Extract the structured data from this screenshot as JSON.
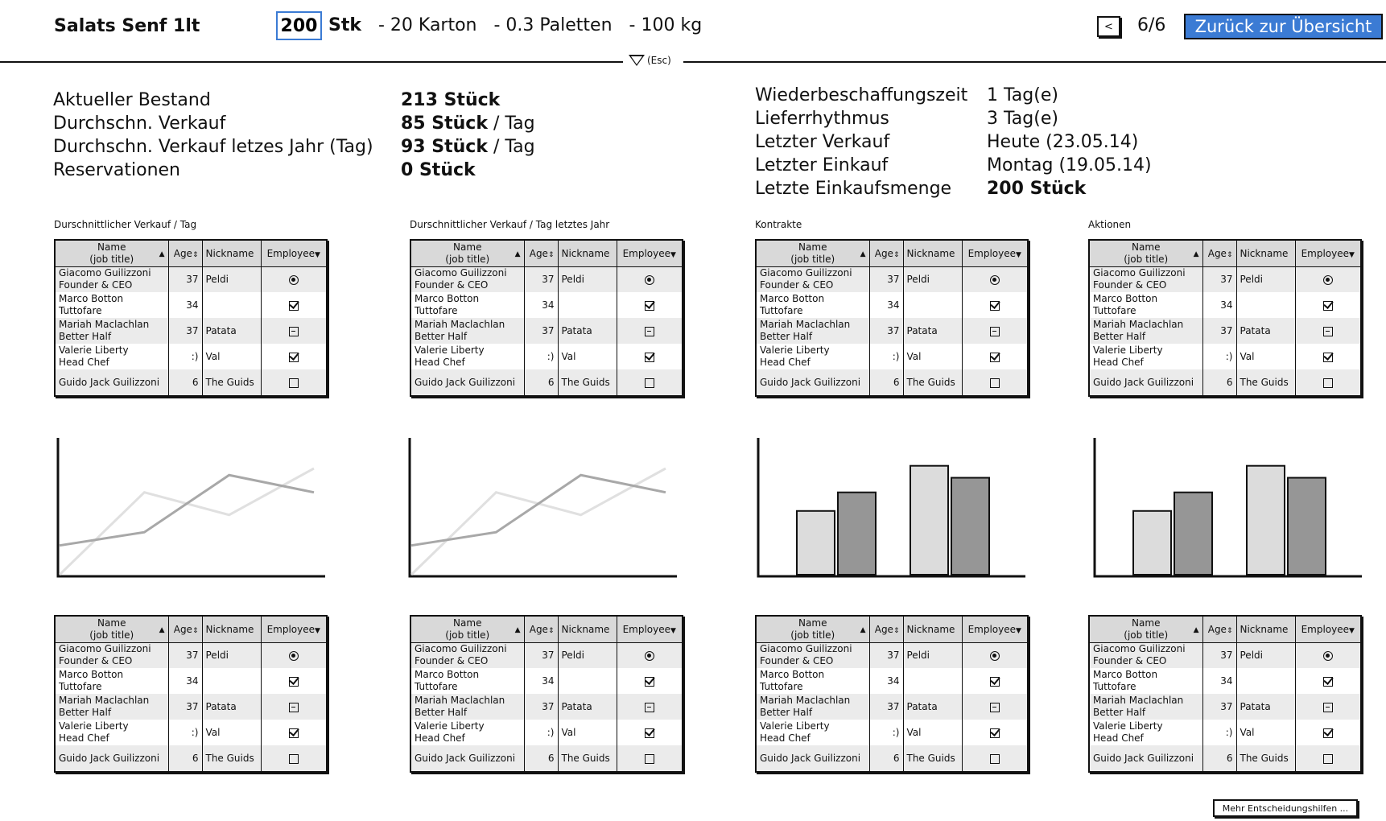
{
  "header": {
    "product": "Salats Senf 1lt",
    "quantity_value": "200",
    "unit": "Stk",
    "karton": "- 20 Karton",
    "paletten": "- 0.3 Paletten",
    "weight": "- 100 kg",
    "prev_label": "<",
    "pager": "6/6",
    "back_label": "Zurück zur Übersicht",
    "collapse_label": "(Esc)"
  },
  "stats_left": [
    {
      "label": "Aktueller Bestand",
      "value": "213 Stück",
      "suffix": ""
    },
    {
      "label": "Durchschn. Verkauf",
      "value": "85 Stück",
      "suffix": " / Tag"
    },
    {
      "label": "Durchschn. Verkauf letzes Jahr (Tag)",
      "value": "93 Stück",
      "suffix": " / Tag"
    },
    {
      "label": "Reservationen",
      "value": "0 Stück",
      "suffix": ""
    }
  ],
  "stats_right": [
    {
      "label": "Wiederbeschaffungszeit",
      "value": "1 Tag(e)",
      "bold": false
    },
    {
      "label": "Lieferrhythmus",
      "value": "3 Tag(e)",
      "bold": false
    },
    {
      "label": "Letzter Verkauf",
      "value": "Heute (23.05.14)",
      "bold": false
    },
    {
      "label": "Letzter Einkauf",
      "value": "Montag (19.05.14)",
      "bold": false
    },
    {
      "label": "Letzte Einkaufsmenge",
      "value": "200 Stück",
      "bold": true
    }
  ],
  "sections": [
    {
      "title": "Durschnittlicher Verkauf / Tag"
    },
    {
      "title": "Durschnittlicher Verkauf / Tag letztes Jahr"
    },
    {
      "title": "Kontrakte"
    },
    {
      "title": "Aktionen"
    }
  ],
  "table": {
    "headers": {
      "name": "Name",
      "name_sub": "(job title)",
      "age": "Age",
      "nickname": "Nickname",
      "employee": "Employee"
    },
    "rows": [
      {
        "name": "Giacomo Guilizzoni",
        "title": "Founder & CEO",
        "age": "37",
        "nickname": "Peldi",
        "employee": "radio"
      },
      {
        "name": "Marco Botton",
        "title": "Tuttofare",
        "age": "34",
        "nickname": "",
        "employee": "check"
      },
      {
        "name": "Mariah Maclachlan",
        "title": "Better Half",
        "age": "37",
        "nickname": "Patata",
        "employee": "minus"
      },
      {
        "name": "Valerie Liberty",
        "title": "Head Chef",
        "age": ":)",
        "nickname": "Val",
        "employee": "check"
      },
      {
        "name": "Guido Jack Guilizzoni",
        "title": "",
        "age": "6",
        "nickname": "The Guids",
        "employee": "empty"
      }
    ]
  },
  "footer": {
    "more_label": "Mehr Entscheidungshilfen ..."
  },
  "chart_data": [
    {
      "type": "line",
      "x": [
        0,
        1,
        2,
        3
      ],
      "series": [
        {
          "values": [
            0,
            62,
            45,
            80
          ],
          "color": "#e0e0e0"
        },
        {
          "values": [
            22,
            32,
            75,
            62
          ],
          "color": "#a8a8a8"
        }
      ]
    },
    {
      "type": "line",
      "x": [
        0,
        1,
        2,
        3
      ],
      "series": [
        {
          "values": [
            0,
            62,
            45,
            80
          ],
          "color": "#e0e0e0"
        },
        {
          "values": [
            22,
            32,
            75,
            62
          ],
          "color": "#a8a8a8"
        }
      ]
    },
    {
      "type": "bar",
      "categories": [
        "1",
        "2"
      ],
      "series": [
        {
          "values": [
            48,
            82
          ],
          "color": "#dcdcdc"
        },
        {
          "values": [
            62,
            73
          ],
          "color": "#969696"
        }
      ]
    },
    {
      "type": "bar",
      "categories": [
        "1",
        "2"
      ],
      "series": [
        {
          "values": [
            48,
            82
          ],
          "color": "#dcdcdc"
        },
        {
          "values": [
            62,
            73
          ],
          "color": "#969696"
        }
      ]
    }
  ]
}
